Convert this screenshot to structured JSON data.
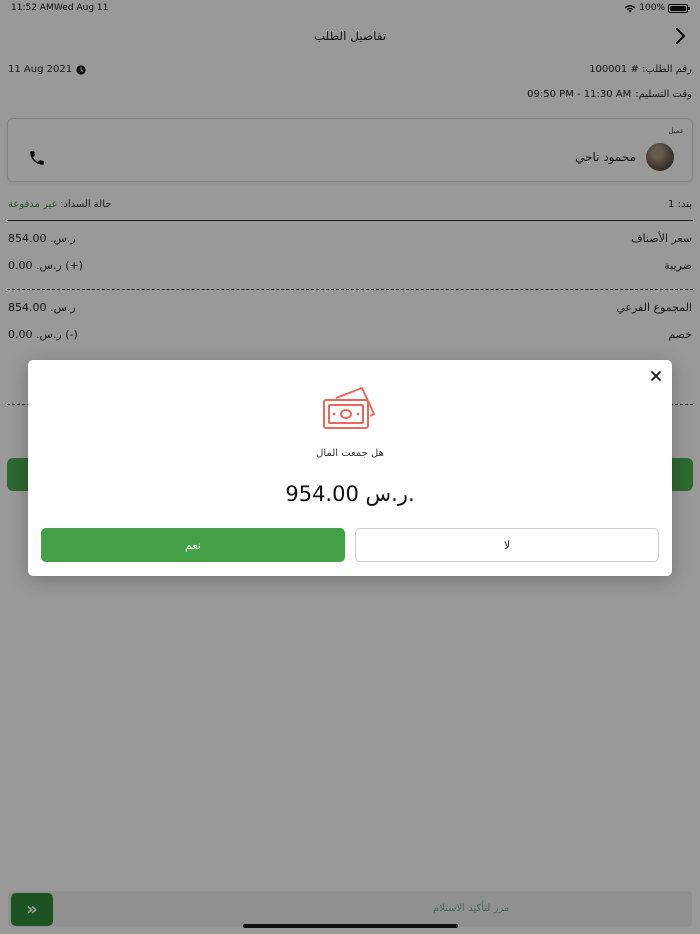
{
  "status_bar": {
    "time": "11:52 AM",
    "date": "Wed Aug 11",
    "battery": "100%"
  },
  "nav": {
    "title": "تفاصيل الطلب"
  },
  "order": {
    "number_label": "رقم الطلب: #",
    "number": "100001",
    "date": "11 Aug 2021",
    "delivery_label": "وقت التسليم:",
    "delivery_time": "09:50 PM - 11:30 AM"
  },
  "customer": {
    "label": "عميل",
    "name": "محمود ناجي"
  },
  "summary": {
    "items_count_label": "بند: 1",
    "payment_status_label": "حالة السداد:",
    "payment_status_value": "غير مدفوعة"
  },
  "lines": [
    {
      "label": "سعر الأصناف",
      "value": "ر.س. 854.00"
    },
    {
      "label": "ضريبة",
      "value": "(+) ر.س. 0.00"
    },
    {
      "label": "المجموع الفرعي",
      "value": "ر.س. 854.00"
    },
    {
      "label": "خصم",
      "value": "(-) ر.س. 0.00"
    }
  ],
  "swipe": {
    "label": "مرر لتأكيد الاستلام"
  },
  "modal": {
    "question": "هل جمعت المال",
    "amount": "954.00 ر.س.",
    "yes_label": "نعم",
    "no_label": "لا"
  },
  "colors": {
    "accent_green": "#43a047",
    "money_icon": "#e8685a",
    "unpaid_text": "#3b9c44"
  }
}
